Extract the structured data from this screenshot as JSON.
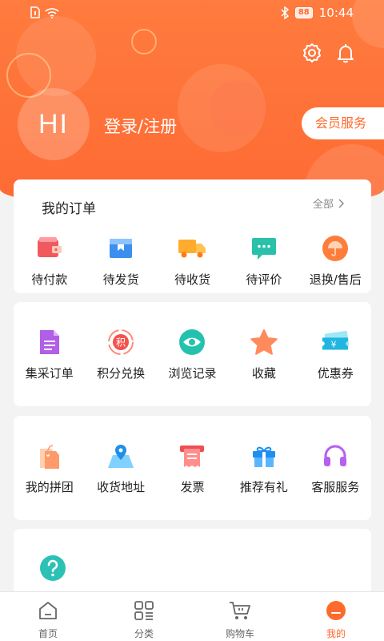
{
  "status": {
    "battery": "88",
    "time": "10:44"
  },
  "profile": {
    "avatar_text": "HI",
    "login_label": "登录/注册",
    "member_label": "会员服务"
  },
  "orders": {
    "title": "我的订单",
    "more_label": "全部",
    "items": [
      {
        "label": "待付款",
        "icon": "wallet-icon"
      },
      {
        "label": "待发货",
        "icon": "package-box-icon"
      },
      {
        "label": "待收货",
        "icon": "delivery-truck-icon"
      },
      {
        "label": "待评价",
        "icon": "comment-bubble-icon"
      },
      {
        "label": "退换/售后",
        "icon": "umbrella-icon"
      }
    ]
  },
  "services1": [
    {
      "label": "集采订单",
      "icon": "document-icon"
    },
    {
      "label": "积分兑换",
      "icon": "points-exchange-icon",
      "badge": "积"
    },
    {
      "label": "浏览记录",
      "icon": "eye-icon"
    },
    {
      "label": "收藏",
      "icon": "star-icon"
    },
    {
      "label": "优惠券",
      "icon": "coupon-ticket-icon",
      "badge": "¥"
    }
  ],
  "services2": [
    {
      "label": "我的拼团",
      "icon": "group-tag-icon"
    },
    {
      "label": "收货地址",
      "icon": "map-location-icon"
    },
    {
      "label": "发票",
      "icon": "invoice-receipt-icon"
    },
    {
      "label": "推荐有礼",
      "icon": "gift-icon"
    },
    {
      "label": "客服服务",
      "icon": "headset-icon"
    }
  ],
  "help": {
    "icon": "help-question-icon"
  },
  "tabbar": [
    {
      "label": "首页",
      "icon": "home-icon",
      "active": false
    },
    {
      "label": "分类",
      "icon": "category-grid-icon",
      "active": false
    },
    {
      "label": "购物车",
      "icon": "shopping-cart-icon",
      "active": false
    },
    {
      "label": "我的",
      "icon": "user-profile-icon",
      "active": true
    }
  ],
  "colors": {
    "accent": "#ff6a2d",
    "header": "#fd6a33",
    "background": "#f3f3f3"
  }
}
